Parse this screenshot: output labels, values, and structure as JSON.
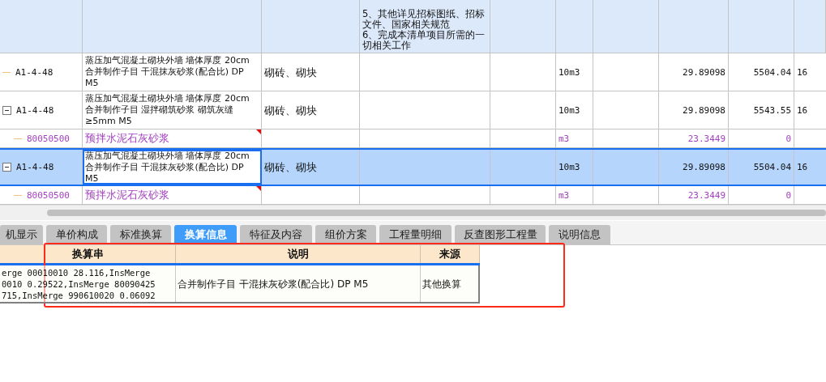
{
  "top_row": {
    "feature_lines": [
      "5、其他详见招标图纸、招标",
      "文件、国家相关规范",
      "6、完成本清单项目所需的一",
      "切相关工作"
    ]
  },
  "rows": [
    {
      "kind": "leaf",
      "selected": false,
      "flagged": false,
      "code": "A1-4-48",
      "name": "蒸压加气混凝土砌块外墙 墙体厚度 20cm  合并制作子目 干混抹灰砂浆(配合比) DP M5",
      "category": "砌砖、砌块",
      "unit": "10m3",
      "quantity": "29.89098",
      "price": "5504.04",
      "column_9": "16"
    },
    {
      "kind": "parent",
      "expanded": true,
      "selected": false,
      "flagged": false,
      "code": "A1-4-48",
      "name": "蒸压加气混凝土砌块外墙 墙体厚度 20cm  合并制作子目 湿拌砌筑砂浆 砌筑灰缝≥5mm M5",
      "category": "砌砖、砌块",
      "unit": "10m3",
      "quantity": "29.89098",
      "price": "5543.55",
      "column_9": "16"
    },
    {
      "kind": "material",
      "selected": false,
      "flagged": true,
      "code": "80050500",
      "name": "预拌水泥石灰砂浆",
      "category": "",
      "unit": "m3",
      "quantity": "23.3449",
      "price": "0",
      "column_9": ""
    },
    {
      "kind": "parent",
      "expanded": true,
      "selected": true,
      "flagged": false,
      "code": "A1-4-48",
      "name": "蒸压加气混凝土砌块外墙 墙体厚度 20cm  合并制作子目 干混抹灰砂浆(配合比) DP M5",
      "category": "砌砖、砌块",
      "unit": "10m3",
      "quantity": "29.89098",
      "price": "5504.04",
      "column_9": "16"
    },
    {
      "kind": "material",
      "selected": false,
      "flagged": true,
      "code": "80050500",
      "name": "预拌水泥石灰砂浆",
      "category": "",
      "unit": "m3",
      "quantity": "23.3449",
      "price": "0",
      "column_9": ""
    }
  ],
  "tabs": [
    {
      "label": "机显示",
      "selected": false
    },
    {
      "label": "单价构成",
      "selected": false
    },
    {
      "label": "标准换算",
      "selected": false
    },
    {
      "label": "换算信息",
      "selected": true
    },
    {
      "label": "特征及内容",
      "selected": false
    },
    {
      "label": "组价方案",
      "selected": false
    },
    {
      "label": "工程量明细",
      "selected": false
    },
    {
      "label": "反查图形工程量",
      "selected": false
    },
    {
      "label": "说明信息",
      "selected": false
    }
  ],
  "conversion_table": {
    "columns": [
      "换算串",
      "说明",
      "来源"
    ],
    "rows": [
      {
        "string_lines": [
          "erge 00010010 28.116,InsMerge",
          "0010 0.29522,InsMerge 80090425",
          "715,InsMerge 990610020 0.06092"
        ],
        "description": "合并制作子目 干混抹灰砂浆(配合比) DP M5",
        "source": "其他换算"
      }
    ]
  }
}
